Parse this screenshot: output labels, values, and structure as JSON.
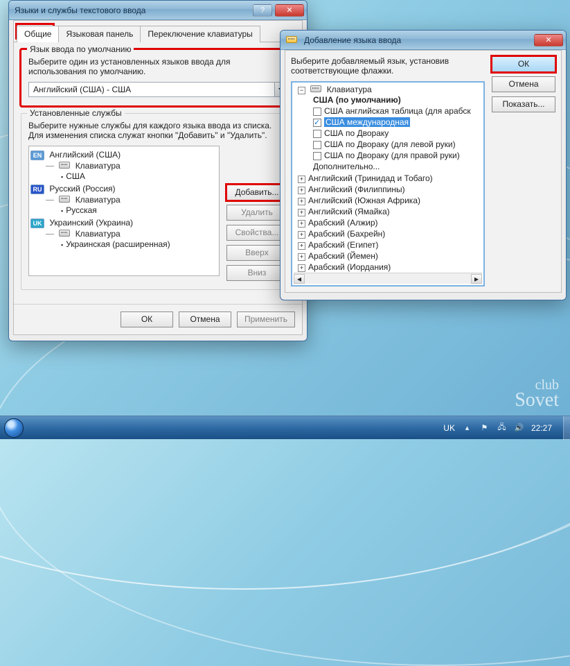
{
  "win1": {
    "title": "Языки и службы текстового ввода",
    "tabs": [
      "Общие",
      "Языковая панель",
      "Переключение клавиатуры"
    ],
    "default_group": {
      "legend": "Язык ввода по умолчанию",
      "desc": "Выберите один из установленных языков ввода для использования по умолчанию.",
      "combo_value": "Английский (США) - США"
    },
    "services_group": {
      "legend": "Установленные службы",
      "desc": "Выберите нужные службы для каждого языка ввода из списка. Для изменения списка служат кнопки \"Добавить\" и \"Удалить\".",
      "tree": {
        "en": {
          "lang": "Английский (США)",
          "kbd_label": "Клавиатура",
          "layouts": [
            "США"
          ]
        },
        "ru": {
          "lang": "Русский (Россия)",
          "kbd_label": "Клавиатура",
          "layouts": [
            "Русская"
          ]
        },
        "uk": {
          "lang": "Украинский (Украина)",
          "kbd_label": "Клавиатура",
          "layouts": [
            "Украинская (расширенная)"
          ]
        }
      },
      "buttons": {
        "add": "Добавить...",
        "remove": "Удалить",
        "props": "Свойства...",
        "up": "Вверх",
        "down": "Вниз"
      }
    },
    "dlg_buttons": {
      "ok": "ОК",
      "cancel": "Отмена",
      "apply": "Применить"
    }
  },
  "win2": {
    "title": "Добавление языка ввода",
    "desc": "Выберите добавляемый язык, установив соответствующие флажки.",
    "tree": {
      "kbd_root": "Клавиатура",
      "default_label": "США (по умолчанию)",
      "options": [
        "США английская таблица (для арабск",
        "США международная",
        "США по Двораку",
        "США по Двораку (для левой руки)",
        "США по Двораку (для правой руки)",
        "Дополнительно..."
      ],
      "selected_index": 1,
      "langs": [
        "Английский (Тринидад и Тобаго)",
        "Английский (Филиппины)",
        "Английский (Южная Африка)",
        "Английский (Ямайка)",
        "Арабский (Алжир)",
        "Арабский (Бахрейн)",
        "Арабский (Египет)",
        "Арабский (Йемен)",
        "Арабский (Иордания)"
      ]
    },
    "buttons": {
      "ok": "ОК",
      "cancel": "Отмена",
      "preview": "Показать..."
    }
  },
  "taskbar": {
    "lang": "UK",
    "clock": "22:27"
  },
  "watermark": {
    "l1": "club",
    "l2": "Sovet"
  }
}
